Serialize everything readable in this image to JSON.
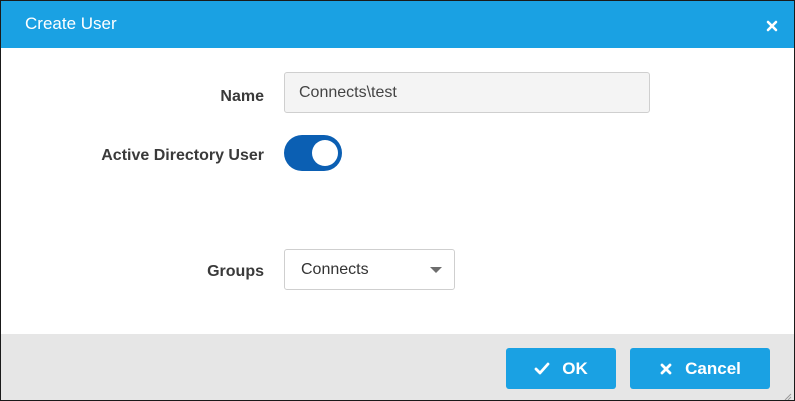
{
  "dialog": {
    "title": "Create User",
    "close_icon": "close-icon"
  },
  "form": {
    "name_label": "Name",
    "name_value": "Connects\\test",
    "ad_label": "Active Directory User",
    "ad_enabled": true,
    "groups_label": "Groups",
    "groups_value": "Connects",
    "groups_icon": "chevron-down-icon"
  },
  "footer": {
    "ok_label": "OK",
    "ok_icon": "check-icon",
    "cancel_label": "Cancel",
    "cancel_icon": "close-icon"
  },
  "colors": {
    "accent": "#1aa1e3",
    "toggle_on": "#0b5fb3",
    "footer_bg": "#e6e6e6"
  }
}
